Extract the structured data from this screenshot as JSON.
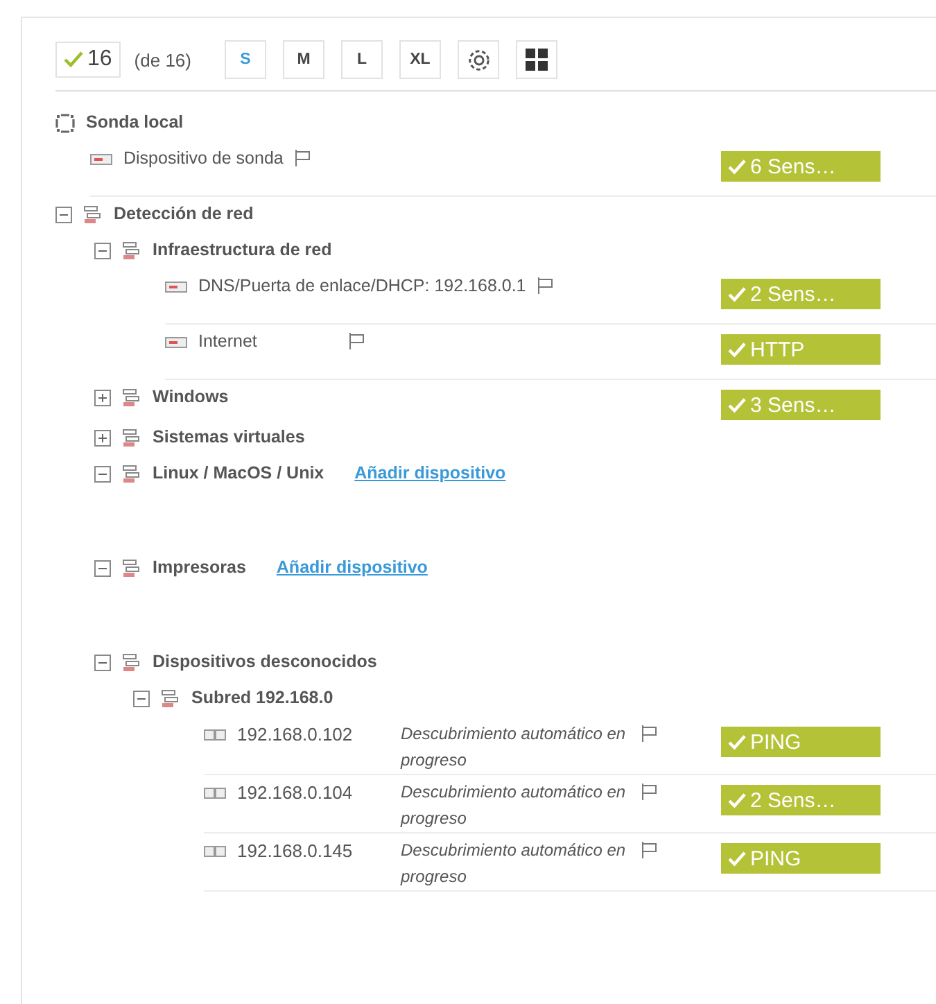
{
  "toolbar": {
    "count": "16",
    "total": "(de 16)",
    "sizes": [
      {
        "label": "S",
        "selected": true
      },
      {
        "label": "M",
        "selected": false
      },
      {
        "label": "L",
        "selected": false
      },
      {
        "label": "XL",
        "selected": false
      }
    ]
  },
  "tree": [
    {
      "kind": "probe",
      "name": "Sonda local",
      "children": [
        {
          "kind": "device",
          "name": "Dispositivo de sonda",
          "badge": "6 Sens…"
        }
      ]
    },
    {
      "kind": "group",
      "name": "Detección de red",
      "expanded": true,
      "children": [
        {
          "kind": "group",
          "name": "Infraestructura de red",
          "expanded": true,
          "children": [
            {
              "kind": "device",
              "name": "DNS/Puerta de enlace/DHCP: 192.168.0.1",
              "badge": "2 Sens…"
            },
            {
              "kind": "device",
              "name": "Internet",
              "badge": "HTTP"
            }
          ]
        },
        {
          "kind": "group",
          "name": "Windows",
          "expanded": false,
          "badge": "3 Sens…"
        },
        {
          "kind": "group",
          "name": "Sistemas virtuales",
          "expanded": false
        },
        {
          "kind": "group",
          "name": "Linux / MacOS / Unix",
          "expanded": true,
          "action": "Añadir dispositivo"
        },
        {
          "kind": "group",
          "name": "Impresoras",
          "expanded": true,
          "action": "Añadir dispositivo"
        },
        {
          "kind": "group",
          "name": "Dispositivos desconocidos",
          "expanded": true,
          "children": [
            {
              "kind": "group",
              "name": "Subred 192.168.0",
              "expanded": true,
              "children": [
                {
                  "kind": "unknown",
                  "name": "192.168.0.102",
                  "status": "Descubrimiento automático en progreso",
                  "badge": "PING"
                },
                {
                  "kind": "unknown",
                  "name": "192.168.0.104",
                  "status": "Descubrimiento automático en progreso",
                  "badge": "2 Sens…"
                },
                {
                  "kind": "unknown",
                  "name": "192.168.0.145",
                  "status": "Descubrimiento automático en progreso",
                  "badge": "PING"
                }
              ]
            }
          ]
        }
      ]
    }
  ]
}
